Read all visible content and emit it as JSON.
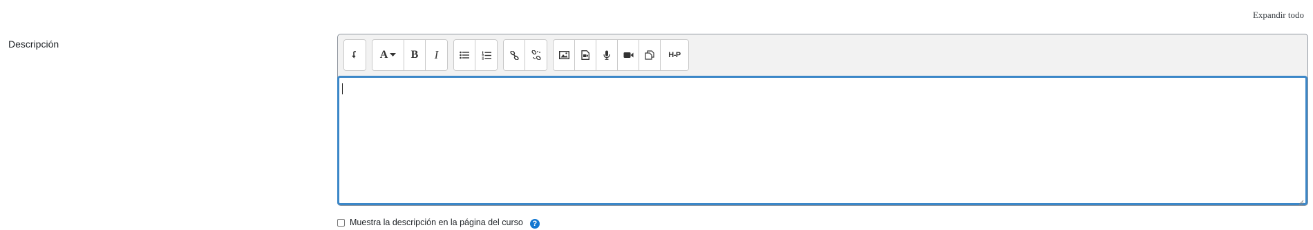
{
  "header": {
    "expand_all_label": "Expandir todo"
  },
  "field": {
    "label": "Descripción"
  },
  "editor": {
    "toolbar_groups": [
      [
        "collapse-toolbar-icon"
      ],
      [
        "font-style-dropdown-icon",
        "bold-icon",
        "italic-icon"
      ],
      [
        "unordered-list-icon",
        "ordered-list-icon"
      ],
      [
        "link-icon",
        "unlink-icon"
      ],
      [
        "image-icon",
        "media-icon",
        "record-audio-icon",
        "record-video-icon",
        "manage-files-icon",
        "h5p-icon"
      ]
    ],
    "labels": {
      "bold": "B",
      "italic": "I",
      "font": "A",
      "h5p": "H-P"
    },
    "content": ""
  },
  "option": {
    "label": "Muestra la descripción en la página del curso",
    "checked": false,
    "help_symbol": "?"
  },
  "colors": {
    "focus_border": "#3b87c8",
    "help": "#1177d1"
  }
}
